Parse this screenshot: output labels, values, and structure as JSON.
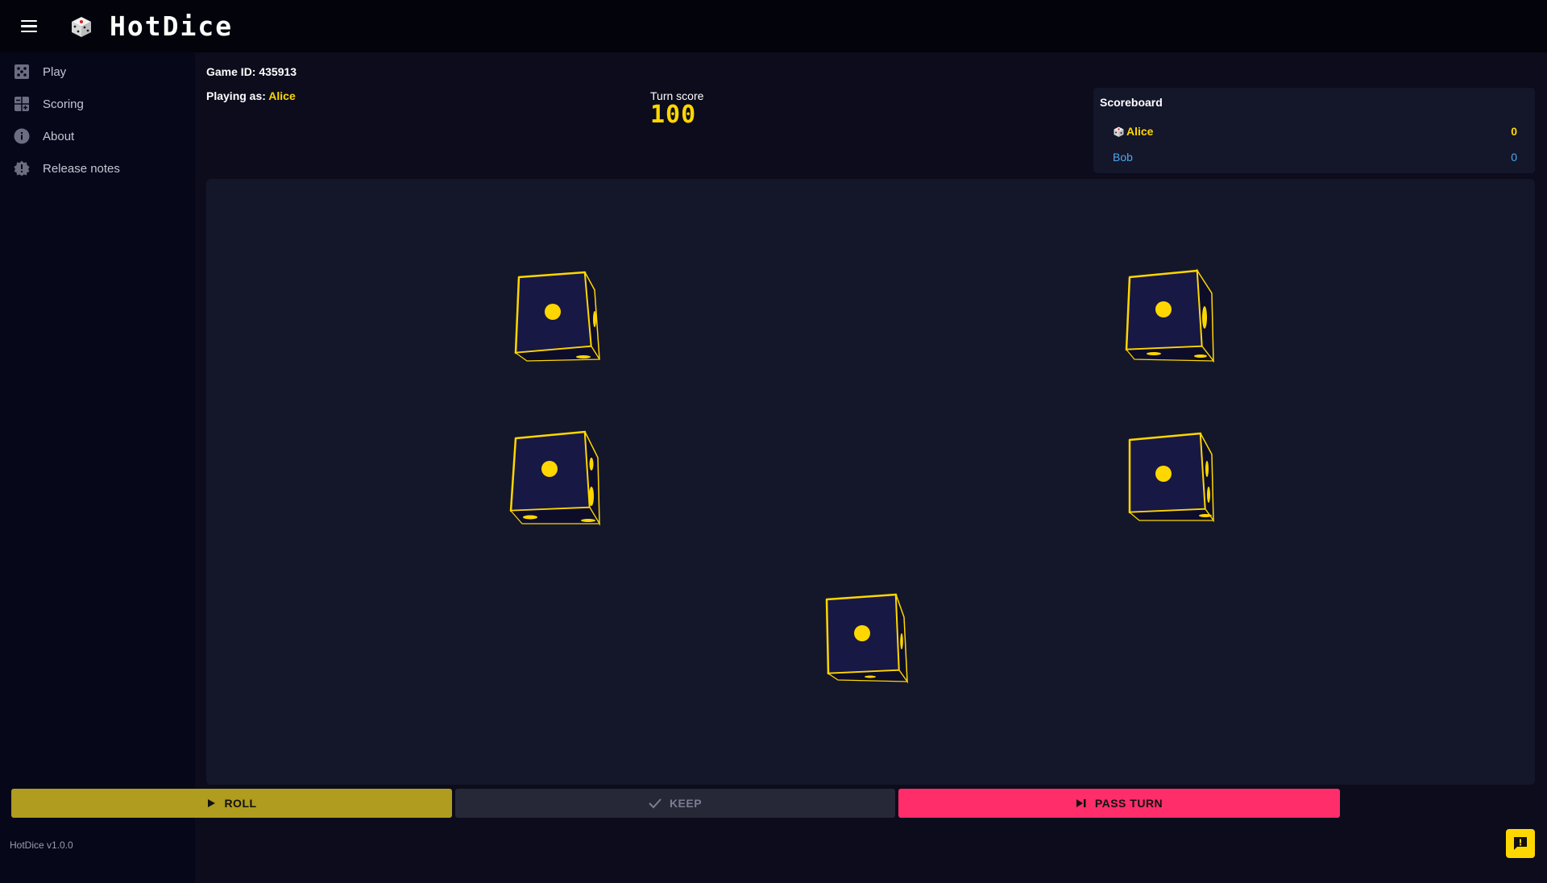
{
  "app": {
    "title": "HotDice",
    "version": "HotDice v1.0.0"
  },
  "sidebar": {
    "items": [
      {
        "label": "Play",
        "icon": "dice-grid-icon"
      },
      {
        "label": "Scoring",
        "icon": "scoring-grid-icon"
      },
      {
        "label": "About",
        "icon": "info-icon"
      },
      {
        "label": "Release notes",
        "icon": "badge-icon"
      }
    ]
  },
  "game": {
    "id_label": "Game ID: 435913",
    "playing_as_label": "Playing as: ",
    "player_name": "Alice",
    "turn_label": "Turn score",
    "turn_score": "100"
  },
  "scoreboard": {
    "title": "Scoreboard",
    "players": [
      {
        "name": "Alice",
        "score": "0",
        "active": true
      },
      {
        "name": "Bob",
        "score": "0",
        "active": false
      }
    ]
  },
  "dice": [
    {
      "face": 1,
      "kept": false
    },
    {
      "face": 1,
      "kept": false
    },
    {
      "face": 1,
      "kept": false
    },
    {
      "face": 1,
      "kept": false
    },
    {
      "face": 1,
      "kept": false
    }
  ],
  "actions": {
    "roll_label": "ROLL",
    "keep_label": "KEEP",
    "pass_label": "PASS TURN"
  },
  "colors": {
    "accent": "#ffd700",
    "pass": "#ff2d6a",
    "roll": "#b09c1e",
    "opponent": "#4aa8ee"
  }
}
